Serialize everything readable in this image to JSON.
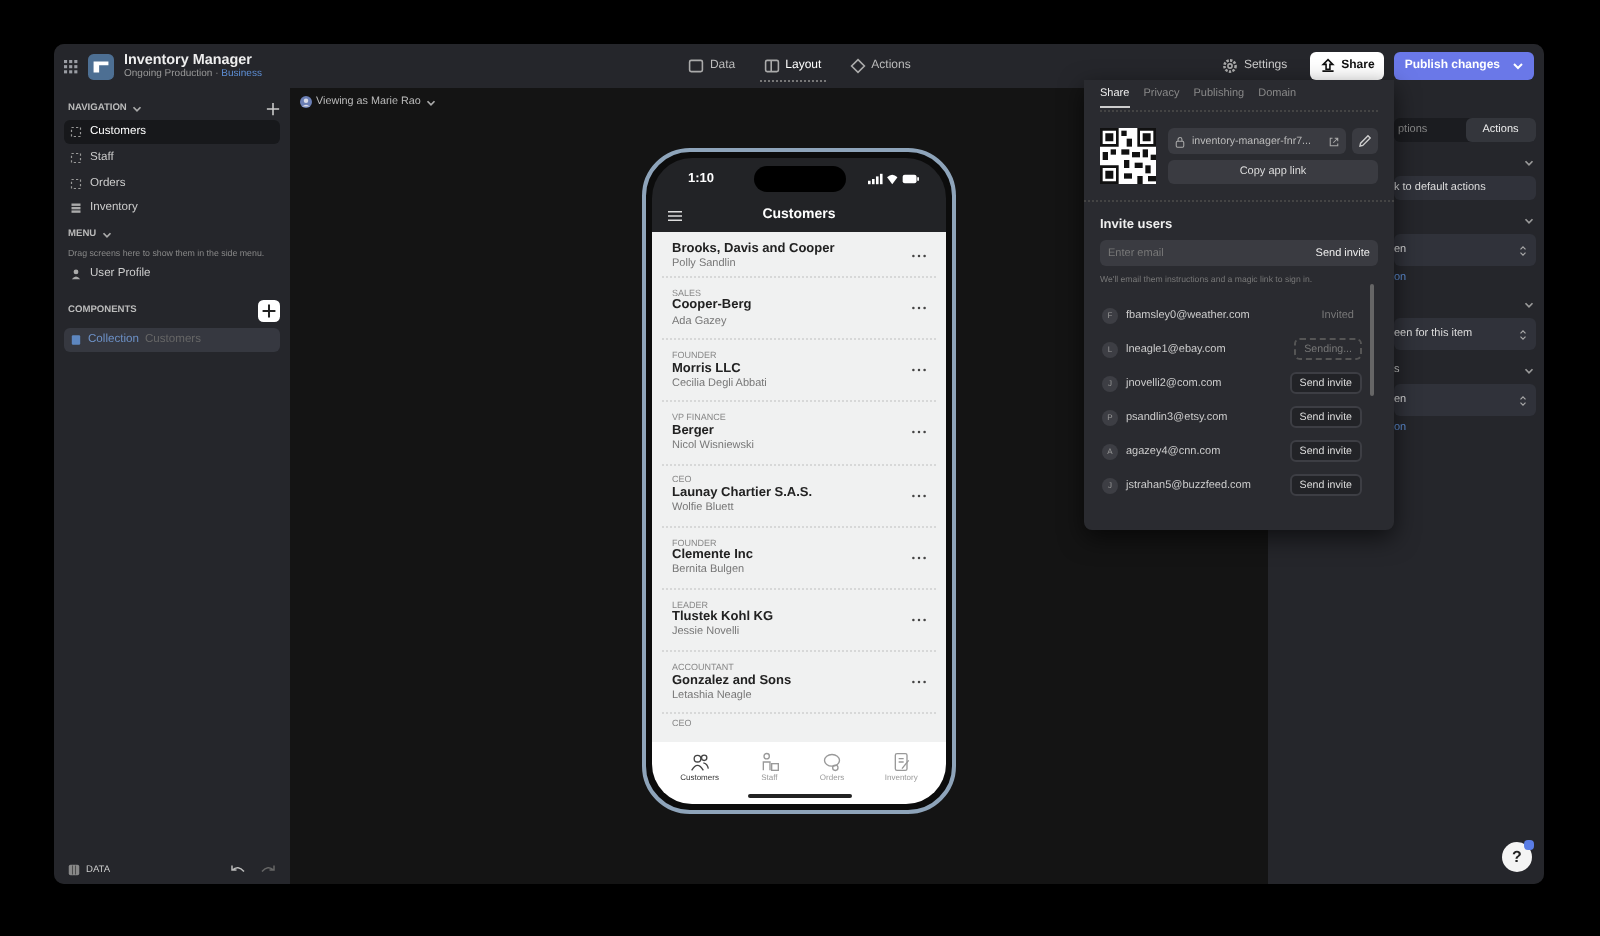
{
  "help_label": "?",
  "top_bar": {
    "app_name": "Inventory Manager",
    "app_subtitle": "Ongoing Production ·",
    "plan": "Business",
    "modes": [
      {
        "label": "Data",
        "kind": "data",
        "selected": false
      },
      {
        "label": "Layout",
        "kind": "layout",
        "selected": true
      },
      {
        "label": "Actions",
        "kind": "actions",
        "selected": false
      }
    ],
    "settings_label": "Settings",
    "share_label": "Share",
    "publish_label": "Publish changes"
  },
  "sidebar": {
    "navigation_heading": "NAVIGATION",
    "screens": [
      {
        "label": "Customers",
        "kind": "screen",
        "selected": true
      },
      {
        "label": "Staff",
        "kind": "screen",
        "selected": false
      },
      {
        "label": "Orders",
        "kind": "screen",
        "selected": false
      },
      {
        "label": "Inventory",
        "kind": "table",
        "selected": false
      }
    ],
    "menu_heading": "MENU",
    "menu_hint": "Drag screens here to show them in the side menu.",
    "menu_items": [
      "User Profile"
    ],
    "components_heading": "COMPONENTS",
    "components": [
      {
        "kind_label": "Collection",
        "source": "Customers",
        "selected": true
      }
    ],
    "data_label": "DATA"
  },
  "canvas": {
    "viewing_as": "Viewing as Marie Rao",
    "phone": {
      "time": "1:10",
      "title": "Customers",
      "items": [
        {
          "company": "Brooks, Davis and Cooper",
          "contact": "Polly Sandlin"
        },
        {
          "role": "SALES",
          "company": "Cooper-Berg",
          "contact": "Ada Gazey"
        },
        {
          "role": "FOUNDER",
          "company": "Morris LLC",
          "contact": "Cecilia Degli Abbati"
        },
        {
          "role": "VP FINANCE",
          "company": "Berger",
          "contact": "Nicol Wisniewski"
        },
        {
          "role": "CEO",
          "company": "Launay Chartier S.A.S.",
          "contact": "Wolfie Bluett"
        },
        {
          "role": "FOUNDER",
          "company": "Clemente Inc",
          "contact": "Bernita Bulgen"
        },
        {
          "role": "LEADER",
          "company": "Tlustek Kohl KG",
          "contact": "Jessie Novelli"
        },
        {
          "role": "ACCOUNTANT",
          "company": "Gonzalez and Sons",
          "contact": "Letashia Neagle"
        },
        {
          "role": "CEO"
        }
      ],
      "tabs": [
        {
          "label": "Customers",
          "kind": "people",
          "selected": true
        },
        {
          "label": "Staff",
          "kind": "staff",
          "selected": false
        },
        {
          "label": "Orders",
          "kind": "orders",
          "selected": false
        },
        {
          "label": "Inventory",
          "kind": "inventory",
          "selected": false
        }
      ]
    }
  },
  "share_popover": {
    "tabs": [
      {
        "label": "Share",
        "selected": true
      },
      {
        "label": "Privacy",
        "selected": false
      },
      {
        "label": "Publishing",
        "selected": false
      },
      {
        "label": "Domain",
        "selected": false
      }
    ],
    "app_link": "inventory-manager-fnr7...",
    "copy_label": "Copy app link",
    "invite_heading": "Invite users",
    "email_placeholder": "Enter email",
    "send_label": "Send invite",
    "hint": "We'll email them instructions and a magic link to sign in.",
    "users": [
      {
        "initial": "F",
        "email": "fbamsley0@weather.com",
        "kind": "invited",
        "status": "Invited"
      },
      {
        "initial": "L",
        "email": "lneagle1@ebay.com",
        "kind": "sending",
        "status": "Sending..."
      },
      {
        "initial": "J",
        "email": "jnovelli2@com.com",
        "kind": "send",
        "status": "Send invite"
      },
      {
        "initial": "P",
        "email": "psandlin3@etsy.com",
        "kind": "send",
        "status": "Send invite"
      },
      {
        "initial": "A",
        "email": "agazey4@cnn.com",
        "kind": "send",
        "status": "Send invite"
      },
      {
        "initial": "J",
        "email": "jstrahan5@buzzfeed.com",
        "kind": "send",
        "status": "Send invite"
      }
    ]
  },
  "properties_panel": {
    "tabs": [
      {
        "label": "ptions",
        "selected": false
      },
      {
        "label": "Actions",
        "selected": true
      }
    ],
    "sections": [
      {
        "items": [
          {
            "kind": "field",
            "text": "k to default actions"
          }
        ]
      },
      {
        "items": [
          {
            "kind": "select",
            "text": "en"
          },
          {
            "kind": "link",
            "text": "on"
          }
        ]
      },
      {
        "items": [
          {
            "kind": "select",
            "text": "een for this item"
          }
        ]
      },
      {
        "heading": "s",
        "items": [
          {
            "kind": "select",
            "text": "en"
          },
          {
            "kind": "link",
            "text": "on"
          }
        ]
      }
    ]
  }
}
